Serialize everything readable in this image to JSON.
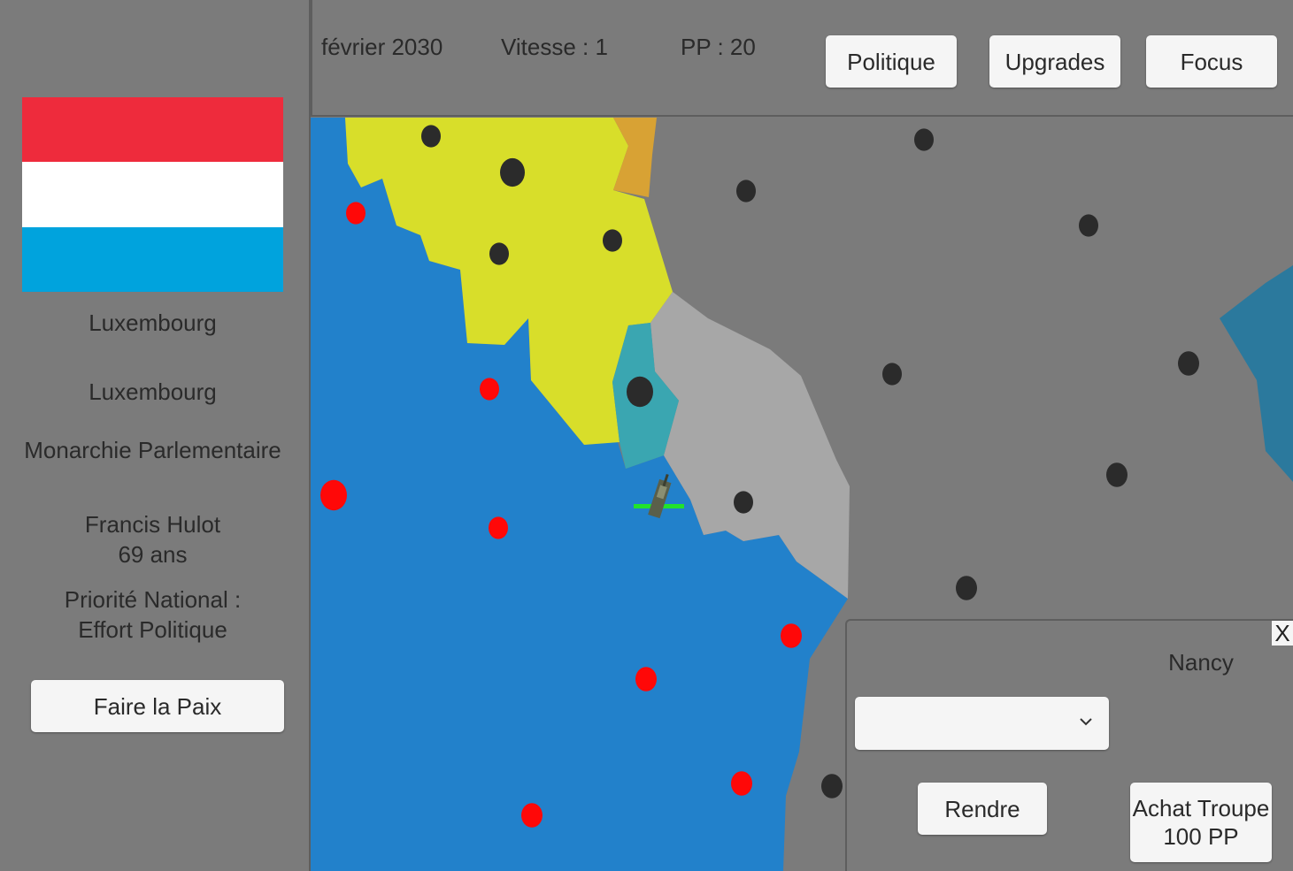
{
  "country": {
    "flag_colors": [
      "#ee2b3c",
      "#ffffff",
      "#00a3dd"
    ],
    "name": "Luxembourg",
    "capital": "Luxembourg",
    "government": "Monarchie Parlementaire",
    "leader_name": "Francis Hulot",
    "leader_age": "69 ans",
    "priority_label": "Priorité National :",
    "priority_value": "Effort Politique",
    "peace_button": "Faire la Paix"
  },
  "top_bar": {
    "date": "février 2030",
    "speed": "Vitesse : 1",
    "pp": "PP : 20",
    "buttons": {
      "politics": "Politique",
      "upgrades": "Upgrades",
      "focus": "Focus"
    }
  },
  "province_panel": {
    "close": "X",
    "province": "Nancy",
    "dropdown_value": "",
    "surrender_button": "Rendre",
    "buy_troop_button": "Achat Troupe\n100 PP"
  },
  "map_colors": {
    "sea": "#2281cb",
    "neutral_land": "#7b7b7b",
    "yellow_country": "#d8de2a",
    "orange_country": "#d8a234",
    "teal_country": "#3aa6b1",
    "light_grey_country": "#a7a7a7",
    "dark_teal_country": "#2b799d",
    "city_neutral": "#2b2b2b",
    "city_enemy": "#ff0808",
    "unit_healthbar": "#22e32b"
  }
}
